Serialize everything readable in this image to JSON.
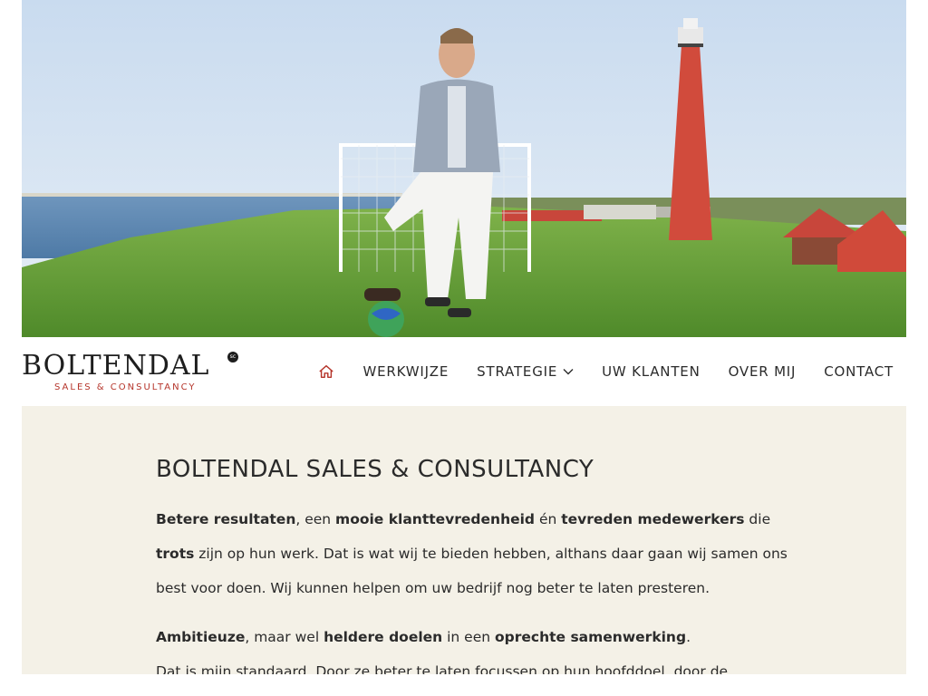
{
  "hero": {
    "image": "man-with-football-goal-and-lighthouse-photo"
  },
  "header": {
    "logo": {
      "main": "BOLTENDAL",
      "badge": "sc",
      "sub": "SALES & CONSULTANCY"
    },
    "nav": {
      "home_icon": "home-icon",
      "items": [
        {
          "label": "WERKWIJZE"
        },
        {
          "label": "STRATEGIE",
          "dropdown_icon": "chevron-down-icon"
        },
        {
          "label": "UW KLANTEN"
        },
        {
          "label": "OVER MIJ"
        },
        {
          "label": "CONTACT"
        }
      ]
    }
  },
  "content": {
    "title": "BOLTENDAL SALES & CONSULTANCY",
    "p1": {
      "b1": "Betere resultaten",
      "t1": ", een ",
      "b2": "mooie klanttevredenheid",
      "t2": " én ",
      "b3": "tevreden medewerkers",
      "t3": " die",
      "b4": "trots",
      "t4": " zijn op hun werk. Dat is wat wij te bieden hebben, althans daar gaan wij samen ons best voor doen. Wij kunnen helpen om uw bedrijf nog beter te laten presteren."
    },
    "p2": {
      "b1": "Ambitieuze",
      "t1": ", maar wel ",
      "b2": "heldere doelen",
      "t2": " in een ",
      "b3": "oprechte samenwerking",
      "t3": "."
    },
    "p3": "Dat is mijn standaard. Door ze beter te laten focussen op hun hoofddoel, door de"
  },
  "colors": {
    "accent": "#b5342a",
    "content_bg": "#f4f1e7",
    "text": "#2b2b2b"
  }
}
